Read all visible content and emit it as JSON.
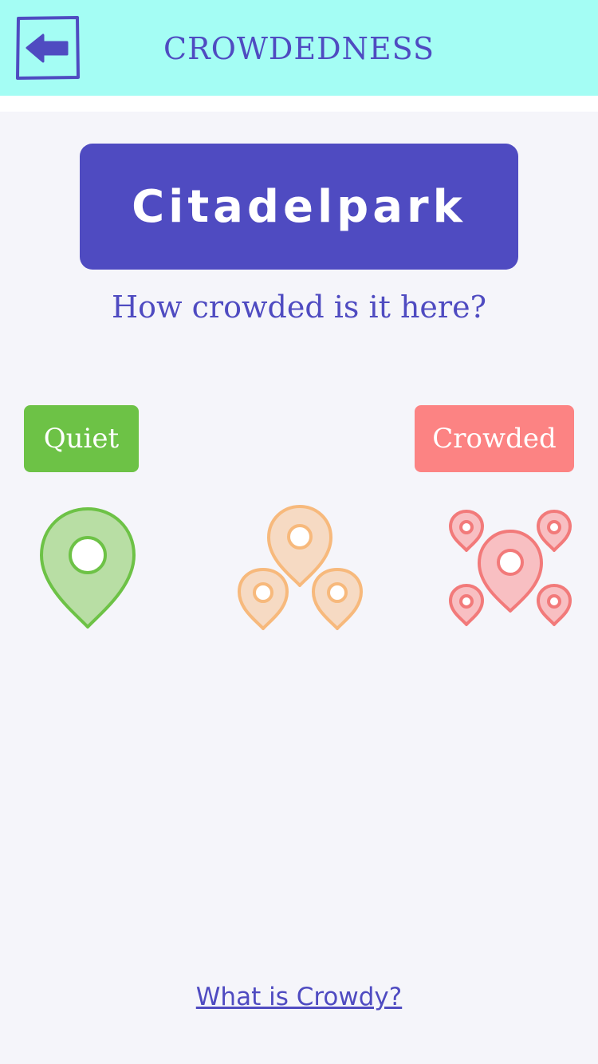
{
  "header": {
    "title": "CROWDEDNESS",
    "back_icon": "arrow-left-icon",
    "background": "#a4fdf4"
  },
  "location": {
    "name": "Citadelpark",
    "color": "#4f4bc1"
  },
  "question": "How crowded is it here?",
  "scale": {
    "low_label": "Quiet",
    "high_label": "Crowded",
    "low_color": "#6dc246",
    "high_color": "#fc8383",
    "options": [
      {
        "icon": "single-pin-icon",
        "color": "#6dc246"
      },
      {
        "icon": "three-pins-icon",
        "color": "#f7b97c"
      },
      {
        "icon": "many-pins-icon",
        "color": "#f27a7a"
      }
    ]
  },
  "footer": {
    "link_text": "What is Crowdy?"
  }
}
